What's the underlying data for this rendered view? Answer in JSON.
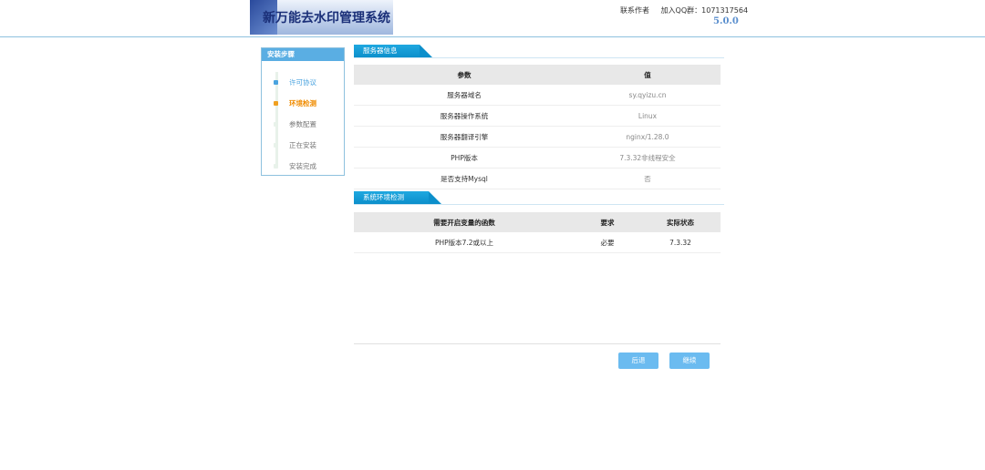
{
  "header": {
    "logo_text": "新万能去水印管理系统",
    "contact_link": "联系作者",
    "qq_group": "加入QQ群：1071317564",
    "version": "5.0.0"
  },
  "sidebar": {
    "title": "安装步骤",
    "steps": [
      {
        "label": "许可协议",
        "state": "done"
      },
      {
        "label": "环境检测",
        "state": "current"
      },
      {
        "label": "参数配置",
        "state": "pending"
      },
      {
        "label": "正在安装",
        "state": "pending"
      },
      {
        "label": "安装完成",
        "state": "pending"
      }
    ]
  },
  "server_info": {
    "title": "服务器信息",
    "headers": [
      "参数",
      "值"
    ],
    "rows": [
      [
        "服务器域名",
        "sy.qyizu.cn"
      ],
      [
        "服务器操作系统",
        "Linux"
      ],
      [
        "服务器翻译引擎",
        "nginx/1.28.0"
      ],
      [
        "PHP版本",
        "7.3.32非线程安全"
      ],
      [
        "是否支持Mysql",
        "否"
      ]
    ]
  },
  "env_check": {
    "title": "系统环境检测",
    "headers": [
      "需要开启变量的函数",
      "要求",
      "实际状态"
    ],
    "rows": [
      [
        "PHP版本7.2或以上",
        "必要",
        "7.3.32"
      ]
    ]
  },
  "buttons": {
    "back": "后退",
    "next": "继续"
  },
  "colors": {
    "accent": "#0c8fcb",
    "sidebar_header": "#5aaee3",
    "current_step": "#f0a020",
    "done_step": "#4aa3df",
    "button": "#6bbbf0"
  }
}
